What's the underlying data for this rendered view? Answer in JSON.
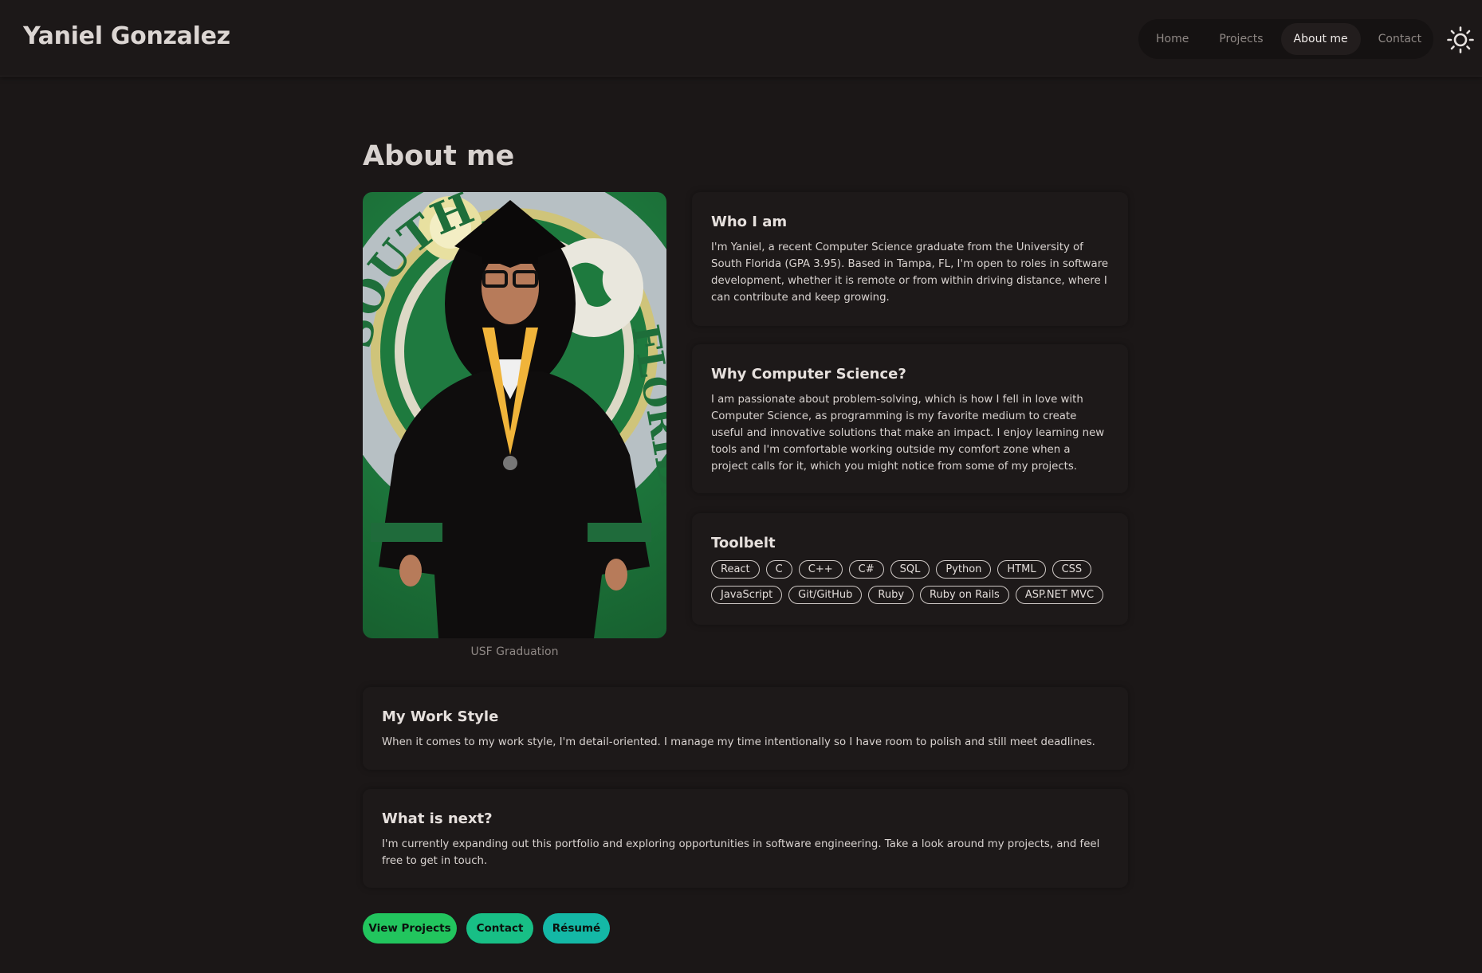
{
  "header": {
    "brand": "Yaniel Gonzalez",
    "nav": [
      "Home",
      "Projects",
      "About me",
      "Contact"
    ],
    "active_nav": "About me",
    "theme_toggle_icon": "sun-icon"
  },
  "page": {
    "title": "About me"
  },
  "photo": {
    "caption": "USF Graduation",
    "seal_text": [
      "SOUTH",
      "FLORIDA"
    ]
  },
  "who": {
    "title": "Who I am",
    "text": "I'm Yaniel, a recent Computer Science graduate from the University of South Florida (GPA 3.95). Based in Tampa, FL, I'm open to roles in software development, whether it is remote or from within driving distance, where I can contribute and keep growing."
  },
  "why": {
    "title": "Why Computer Science?",
    "text": "I am passionate about problem-solving, which is how I fell in love with Computer Science, as programming is my favorite medium to create useful and innovative solutions that make an impact. I enjoy learning new tools and I'm comfortable working outside my comfort zone when a project calls for it, which you might notice from some of my projects."
  },
  "toolbelt": {
    "title": "Toolbelt",
    "tools": [
      "React",
      "C",
      "C++",
      "C#",
      "SQL",
      "Python",
      "HTML",
      "CSS",
      "JavaScript",
      "Git/GitHub",
      "Ruby",
      "Ruby on Rails",
      "ASP.NET MVC"
    ]
  },
  "workstyle": {
    "title": "My Work Style",
    "text": "When it comes to my work style, I'm detail-oriented. I manage my time intentionally so I have room to polish and still meet deadlines."
  },
  "next": {
    "title": "What is next?",
    "text": "I'm currently expanding out this portfolio and exploring opportunities in software engineering. Take a look around my projects, and feel free to get in touch."
  },
  "actions": {
    "view_projects": "View Projects",
    "contact": "Contact",
    "resume": "Résumé"
  },
  "colors": {
    "background": "#1b1717",
    "card": "#1d1919",
    "btn_green": "#22c55e",
    "btn_teal": "#14b8a6",
    "usf_green": "#1e7a3e",
    "usf_gold": "#cfc47a"
  }
}
